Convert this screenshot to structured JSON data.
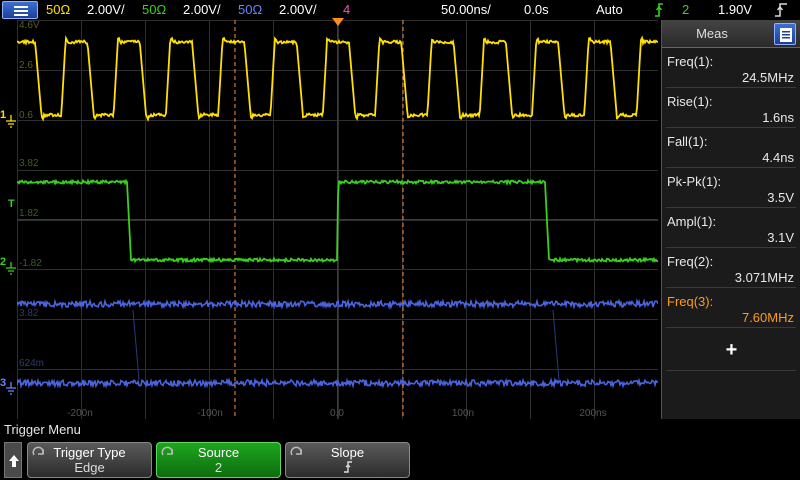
{
  "topbar": {
    "ch1": {
      "imp": "50Ω",
      "scale": "2.00V/",
      "color": "#ffe000"
    },
    "ch2": {
      "imp": "50Ω",
      "scale": "2.00V/",
      "color": "#39d11e"
    },
    "ch3": {
      "imp": "50Ω",
      "scale": "2.00V/",
      "color": "#6a84ff"
    },
    "ch4": {
      "label": "4",
      "color": "#ff4fb6"
    },
    "timebase": "50.00ns/",
    "delay": "0.0s",
    "trigger_mode": "Auto",
    "trigger_icon": "rising-edge-icon",
    "trigger_source": "2",
    "trigger_level": "1.90V"
  },
  "graticule": {
    "ch1_refs": [
      "4.6V",
      "2.6",
      "0.6"
    ],
    "ch2_refs": [
      "3.82",
      "1.82",
      "-1.82"
    ],
    "ch3_refs": [
      "3.82",
      "624m"
    ],
    "x_ticks": [
      "-200n",
      "-100n",
      "0.0",
      "100n",
      "200ns"
    ],
    "markers": {
      "ch1": "1",
      "trig": "T",
      "ch2": "2",
      "ch3": "3"
    }
  },
  "measurements": {
    "title": "Meas",
    "rows": [
      {
        "name": "Freq(1):",
        "value": "24.5MHz",
        "highlight": false
      },
      {
        "name": "Rise(1):",
        "value": "1.6ns",
        "highlight": false
      },
      {
        "name": "Fall(1):",
        "value": "4.4ns",
        "highlight": false
      },
      {
        "name": "Pk-Pk(1):",
        "value": "3.5V",
        "highlight": false
      },
      {
        "name": "Ampl(1):",
        "value": "3.1V",
        "highlight": false
      },
      {
        "name": "Freq(2):",
        "value": "3.071MHz",
        "highlight": false
      },
      {
        "name": "Freq(3):",
        "value": "7.60MHz",
        "highlight": true
      }
    ],
    "add_label": "+"
  },
  "menu": {
    "title": "Trigger Menu",
    "softkeys": [
      {
        "label": "Trigger Type",
        "value": "Edge",
        "active": false
      },
      {
        "label": "Source",
        "value": "2",
        "active": true
      },
      {
        "label": "Slope",
        "value": "",
        "active": false
      }
    ]
  }
}
